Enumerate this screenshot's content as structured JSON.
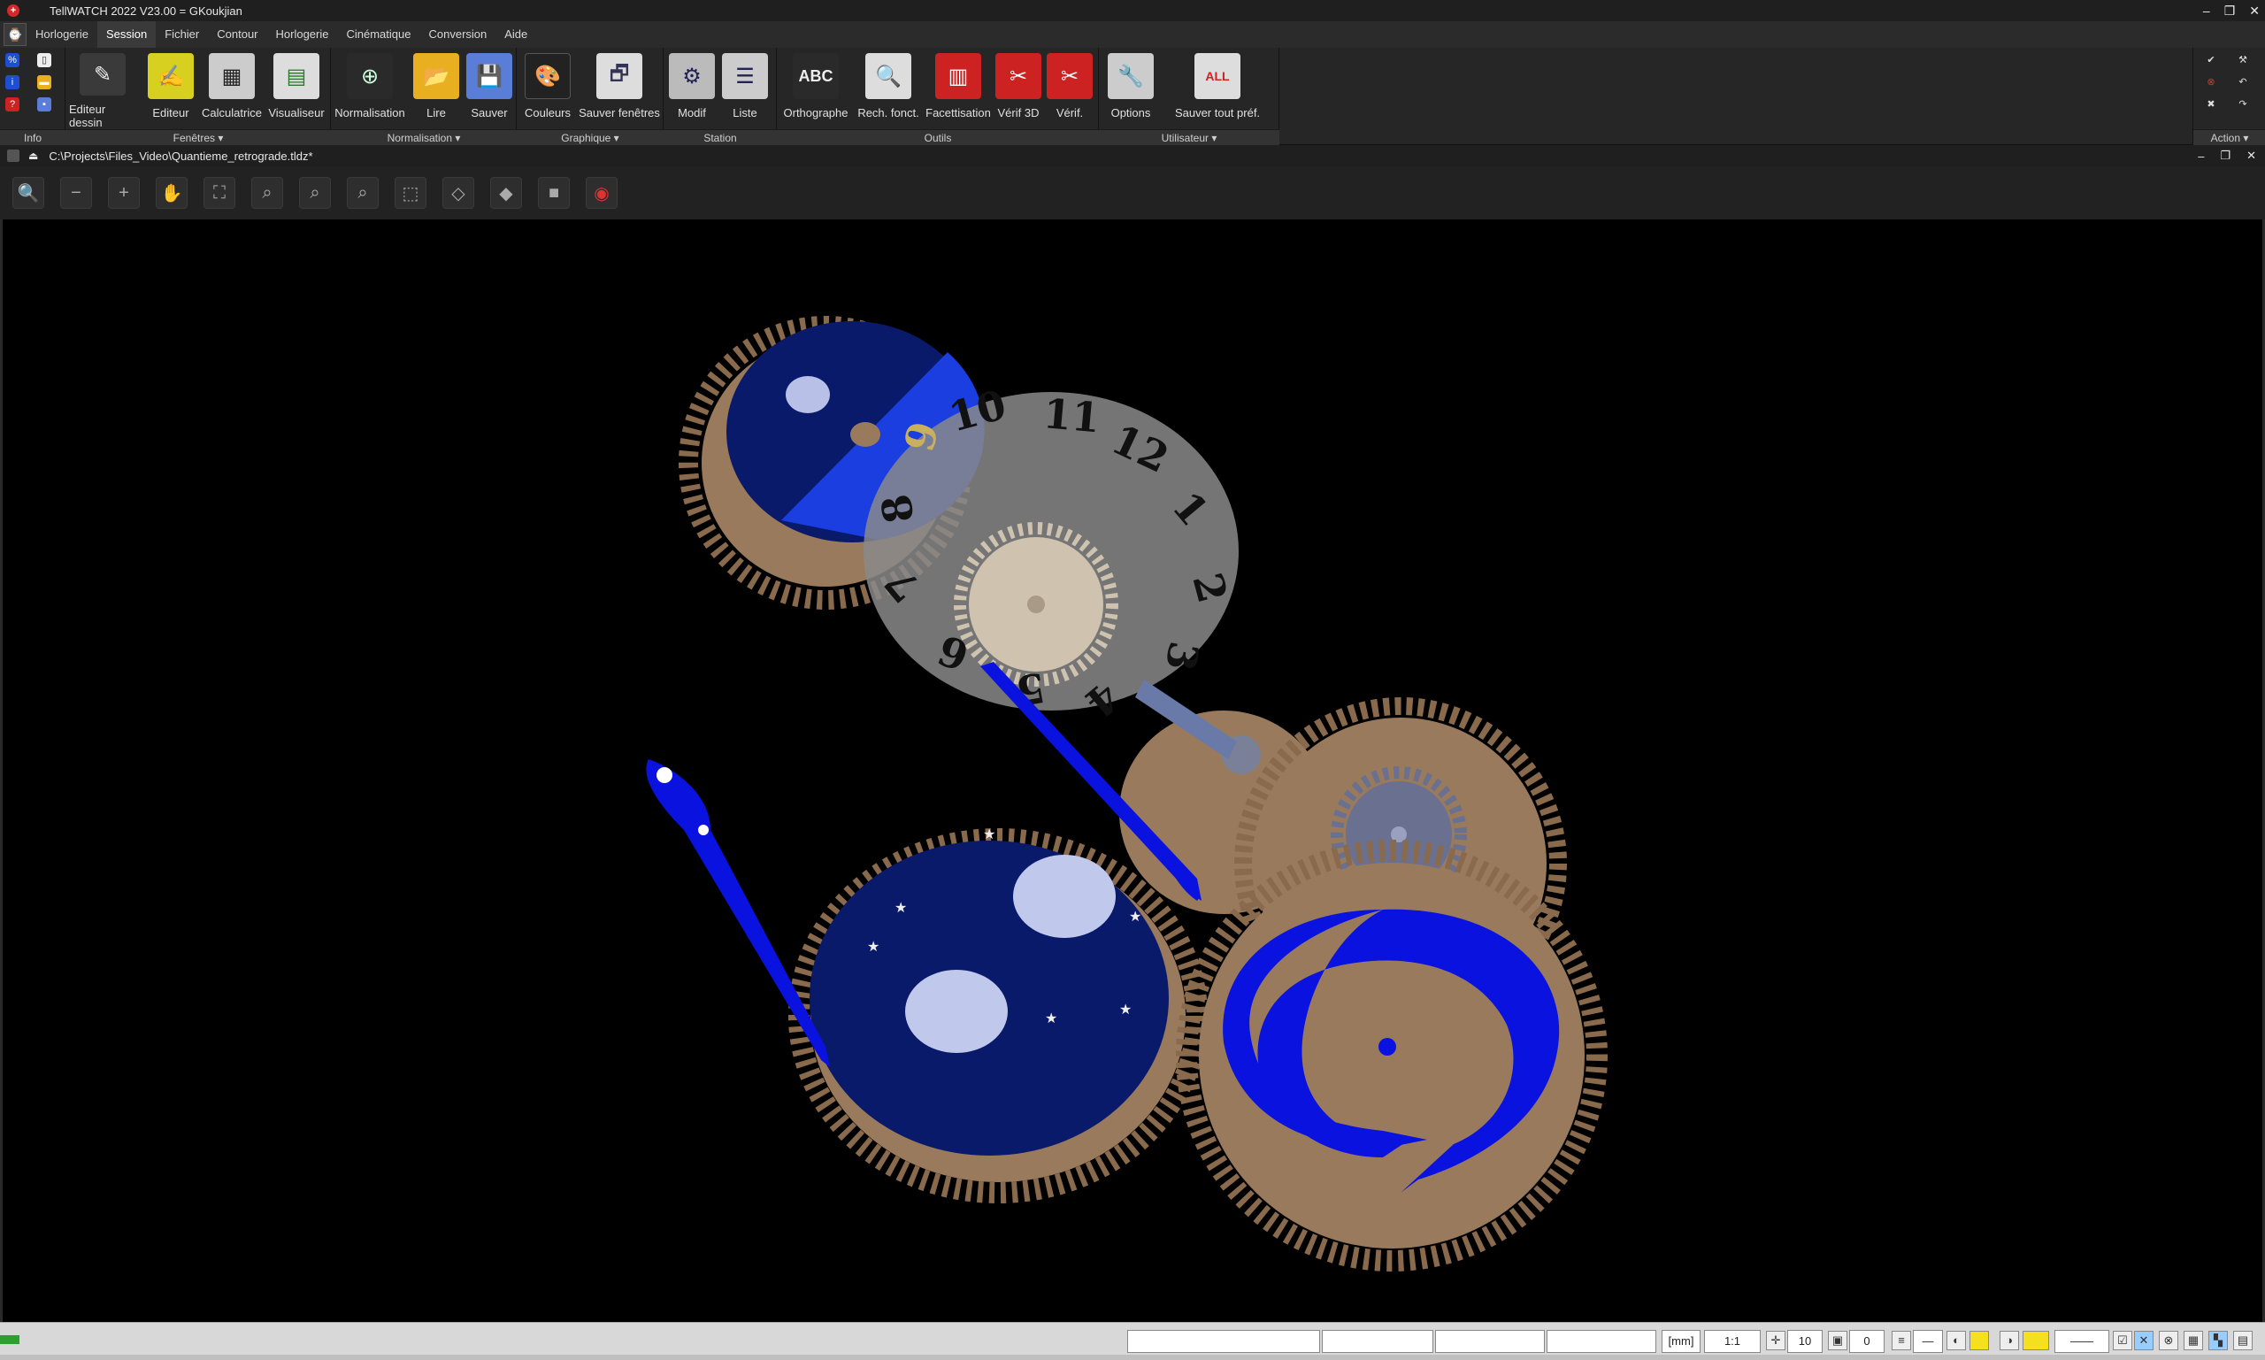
{
  "window": {
    "title": "TellWATCH 2022 V23.00 = GKoukjian",
    "logo": "+",
    "controls": [
      "–",
      "❐",
      "✕"
    ]
  },
  "menu": {
    "logo_icon": "watch-logo-icon",
    "items": [
      "Horlogerie",
      "Session",
      "Fichier",
      "Contour",
      "Horlogerie",
      "Cinématique",
      "Conversion",
      "Aide"
    ],
    "active_index": 1
  },
  "ribbon": {
    "groups": {
      "info": "Info",
      "fenetres": "Fenêtres ▾",
      "normalisation": "Normalisation ▾",
      "graphique": "Graphique ▾",
      "station": "Station",
      "outils": "Outils",
      "utilisateur": "Utilisateur ▾",
      "action": "Action ▾"
    },
    "buttons": {
      "editeur_dessin": "Editeur dessin",
      "editeur": "Editeur",
      "calculatrice": "Calculatrice",
      "visualiseur": "Visualiseur",
      "normalisation": "Normalisation",
      "lire": "Lire",
      "sauver": "Sauver",
      "couleurs": "Couleurs",
      "sauver_fenetres": "Sauver fenêtres",
      "modif": "Modif",
      "liste": "Liste",
      "orthographe": "Orthographe",
      "rech_fonct": "Rech. fonct.",
      "facettisation": "Facettisation",
      "verif_3d": "Vérif 3D",
      "verif": "Vérif.",
      "options": "Options",
      "sauver_tout_pref": "Sauver tout préf."
    },
    "icons": {
      "orthographe": "ABC",
      "sauver_tout_pref": "ALL"
    }
  },
  "document": {
    "path": "C:\\Projects\\Files_Video\\Quantieme_retrograde.tldz*",
    "controls": [
      "–",
      "❐",
      "✕"
    ]
  },
  "dial": {
    "numbers": [
      "10",
      "11",
      "12",
      "1",
      "2",
      "3",
      "4",
      "5",
      "6",
      "7",
      "8",
      "9"
    ]
  },
  "status": {
    "unit": "[mm]",
    "scale": "1:1",
    "grid": "10",
    "layer": "0"
  },
  "colors": {
    "gear": "#9a7a5c",
    "blue_dark": "#0a1a6b",
    "blue_bright": "#0a12e0",
    "dial_gray": "#8a8a8a"
  }
}
